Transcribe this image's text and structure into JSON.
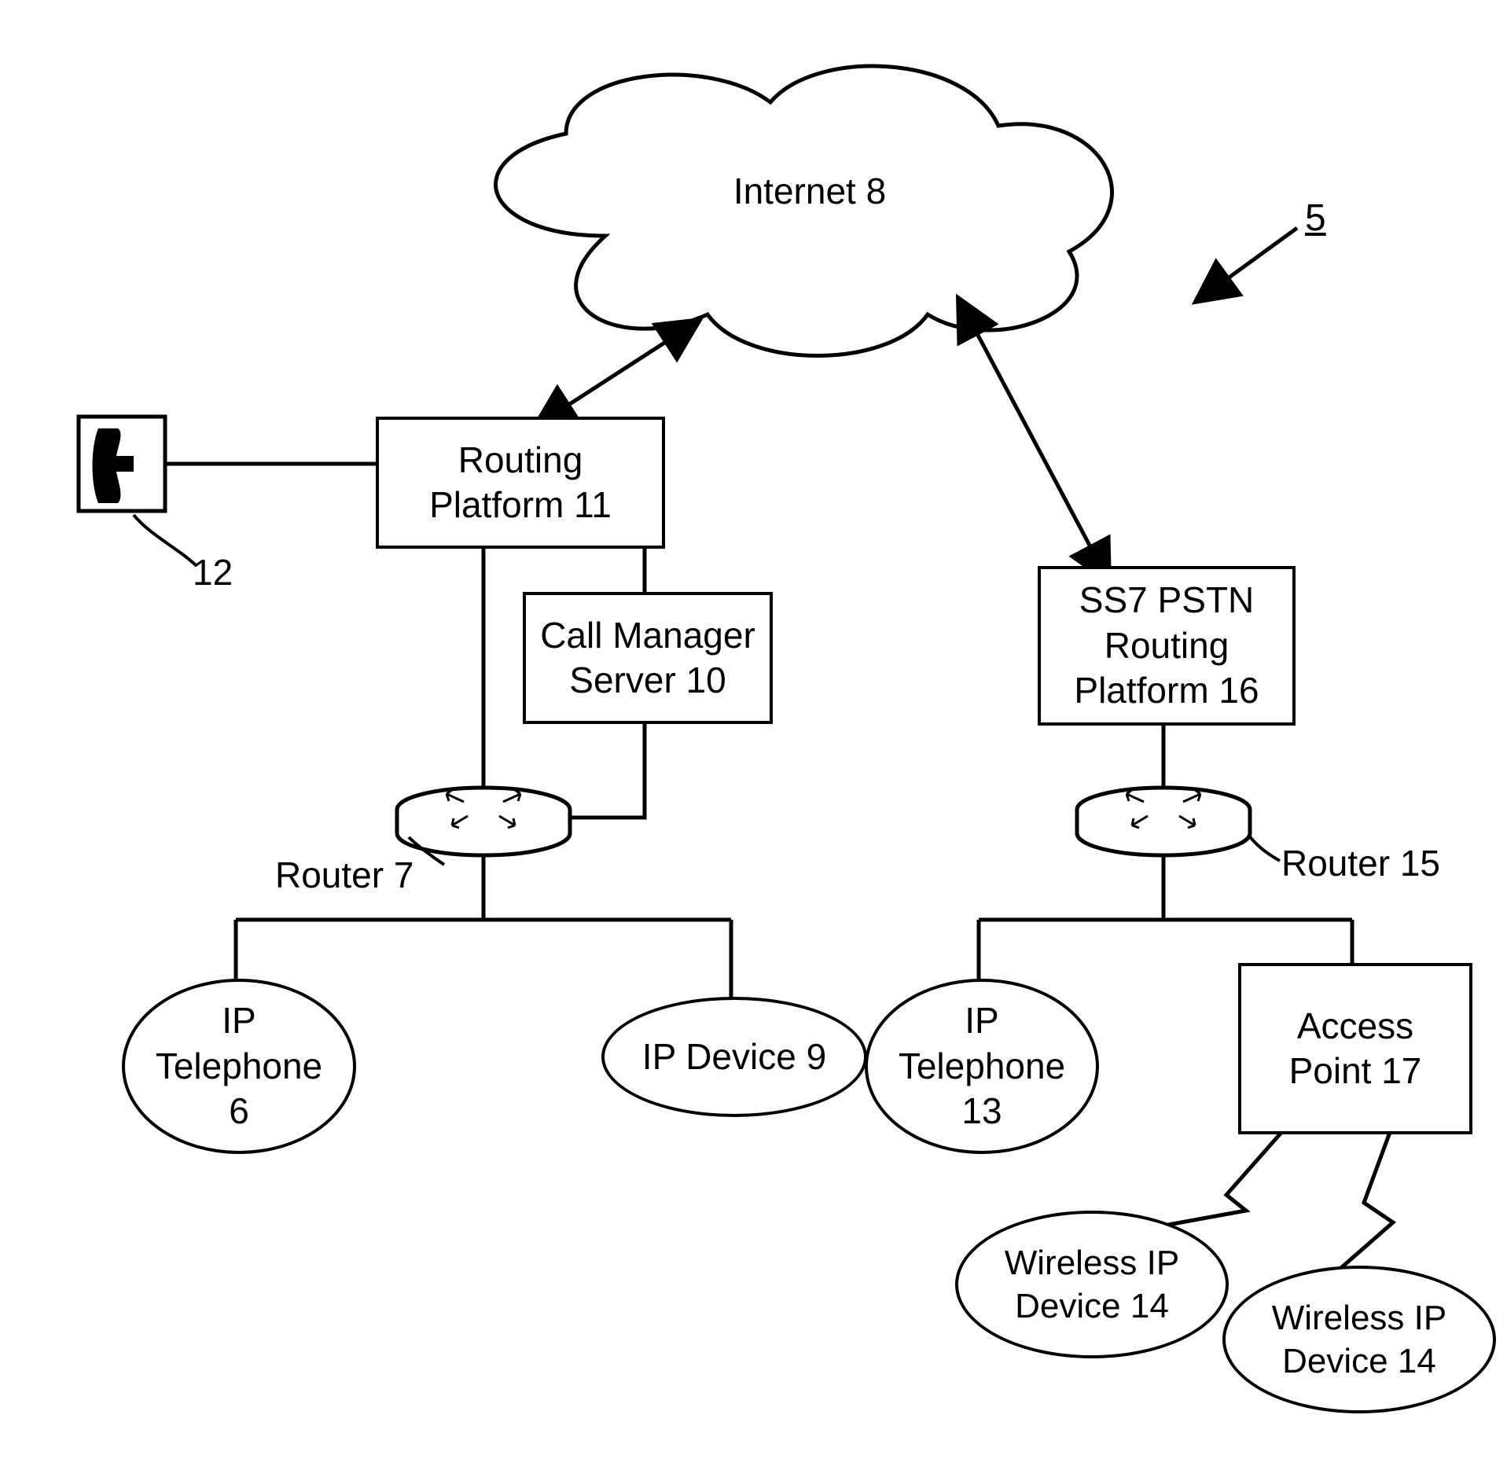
{
  "figure_ref": "5",
  "cloud": {
    "label": "Internet 8"
  },
  "routing_platform_left": {
    "line1": "Routing",
    "line2": "Platform 11"
  },
  "call_manager": {
    "line1": "Call Manager",
    "line2": "Server 10"
  },
  "phone_icon_label": "12",
  "router_left_label": "Router 7",
  "ip_telephone_left": {
    "line1": "IP",
    "line2": "Telephone",
    "line3": "6"
  },
  "ip_device_left": {
    "label": "IP Device 9"
  },
  "ss7": {
    "line1": "SS7 PSTN",
    "line2": "Routing",
    "line3": "Platform 16"
  },
  "router_right_label": "Router 15",
  "ip_telephone_right": {
    "line1": "IP",
    "line2": "Telephone",
    "line3": "13"
  },
  "access_point": {
    "line1": "Access",
    "line2": "Point 17"
  },
  "wireless_left": {
    "line1": "Wireless IP",
    "line2": "Device 14"
  },
  "wireless_right": {
    "line1": "Wireless IP",
    "line2": "Device 14"
  }
}
